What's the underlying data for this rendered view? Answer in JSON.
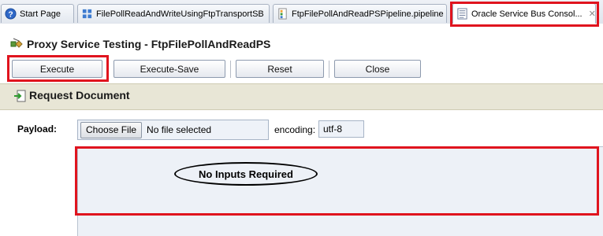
{
  "tabs": [
    {
      "label": "Start Page",
      "icon": "help-icon",
      "active": false
    },
    {
      "label": "FilePollReadAndWriteUsingFtpTransportSB",
      "icon": "application-icon",
      "active": false
    },
    {
      "label": "FtpFilePollAndReadPSPipeline.pipeline",
      "icon": "pipeline-icon",
      "active": false
    },
    {
      "label": "Oracle Service Bus Consol...",
      "icon": "document-icon",
      "active": true,
      "close": "✕"
    }
  ],
  "page": {
    "title": "Proxy Service Testing - FtpFilePollAndReadPS"
  },
  "toolbar": {
    "execute": "Execute",
    "execute_save": "Execute-Save",
    "reset": "Reset",
    "close": "Close"
  },
  "request": {
    "section_title": "Request Document",
    "payload_label": "Payload:",
    "choose_file": "Choose File",
    "file_status": "No file selected",
    "encoding_label": "encoding:",
    "encoding_value": "utf-8",
    "annotation": "No Inputs Required"
  },
  "colors": {
    "highlight": "#e0141e",
    "section_bg": "#e8e6d6",
    "input_area_bg": "#edf1f7"
  }
}
